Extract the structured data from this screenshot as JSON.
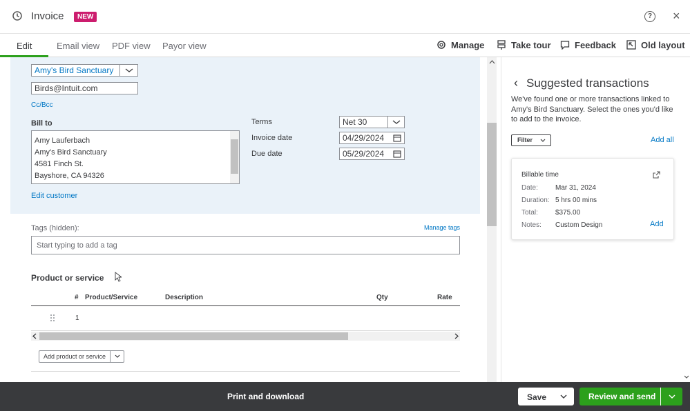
{
  "header": {
    "title": "Invoice",
    "badge": "NEW",
    "help": "?",
    "close": "×"
  },
  "tabs": [
    {
      "label": "Edit",
      "active": true
    },
    {
      "label": "Email view"
    },
    {
      "label": "PDF view"
    },
    {
      "label": "Payor view"
    }
  ],
  "toolbar": {
    "manage": "Manage",
    "take_tour": "Take tour",
    "feedback": "Feedback",
    "old_layout": "Old layout"
  },
  "customer": {
    "name": "Amy's Bird Sanctuary",
    "email": "Birds@Intuit.com",
    "cc_bcc": "Cc/Bcc",
    "bill_to_label": "Bill to",
    "bill_to_lines": [
      "Amy Lauferbach",
      "Amy's Bird Sanctuary",
      "4581 Finch St.",
      "Bayshore, CA  94326"
    ],
    "edit_customer": "Edit customer"
  },
  "terms": {
    "terms_label": "Terms",
    "terms_value": "Net 30",
    "invoice_date_label": "Invoice date",
    "invoice_date": "04/29/2024",
    "due_date_label": "Due date",
    "due_date": "05/29/2024"
  },
  "tags": {
    "label": "Tags (hidden):",
    "manage": "Manage tags",
    "placeholder": "Start typing to add a tag"
  },
  "products": {
    "heading": "Product or service",
    "columns": [
      "#",
      "Product/Service",
      "Description",
      "Qty",
      "Rate"
    ],
    "rows": [
      {
        "num": "1"
      }
    ],
    "add_button": "Add product or service"
  },
  "suggested": {
    "title": "Suggested transactions",
    "description": "We've found one or more transactions linked to Amy's Bird Sanctuary. Select the ones you'd like to add to the invoice.",
    "filter": "Filter",
    "add_all": "Add all",
    "card": {
      "title": "Billable time",
      "date_label": "Date:",
      "date": "Mar 31, 2024",
      "duration_label": "Duration:",
      "duration": "5 hrs 00 mins",
      "total_label": "Total:",
      "total": "$375.00",
      "notes_label": "Notes:",
      "notes": "Custom Design",
      "add": "Add"
    }
  },
  "footer": {
    "print": "Print and download",
    "save": "Save",
    "review": "Review and send"
  },
  "colors": {
    "accent": "#2ca01c",
    "badge": "#cc1d6e",
    "link": "#0077c5",
    "footer": "#393a3d"
  }
}
